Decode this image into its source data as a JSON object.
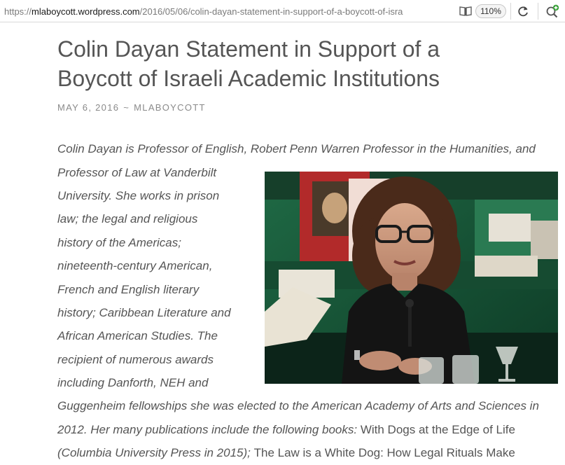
{
  "browser": {
    "url_prefix": "https://",
    "url_domain": "mlaboycott.wordpress.com",
    "url_path": "/2016/05/06/colin-dayan-statement-in-support-of-a-boycott-of-isra",
    "zoom": "110%",
    "icons": [
      "reader-view-icon",
      "reload-icon",
      "search-add-icon"
    ]
  },
  "post": {
    "title_line1": "Colin Dayan Statement in Support of a",
    "title_line2": "Boycott of Israeli Academic Institutions",
    "date": "MAY 6, 2016",
    "separator": "~",
    "author": "MLABOYCOTT",
    "body_lines": [
      "Colin Dayan is Professor of English, Robert Penn Warren Professor in the Humanities, and",
      "Professor of Law at Vanderbilt",
      "University. She works in prison",
      "law; the legal and religious",
      "history of the Americas;",
      "nineteenth-century American,",
      "French and English literary",
      "history; Caribbean Literature and",
      "African American Studies. The",
      "recipient of numerous awards",
      "including Danforth, NEH and",
      "Guggenheim fellowships she was elected to the American Academy of Arts and Sciences in",
      "2012. Her many publications include the following books: ",
      "With Dogs at the Edge of Life",
      " (Columbia University Press in 2015); ",
      "The Law is a White Dog: How Legal Rituals Make"
    ],
    "body_line13_a": "2012. Her many publications include the following books: ",
    "body_line13_b": "With Dogs at the Edge of Life",
    "body_line14_a": "(Columbia University Press in 2015); ",
    "body_line14_b": "The Law is a White Dog: How Legal Rituals Make"
  }
}
